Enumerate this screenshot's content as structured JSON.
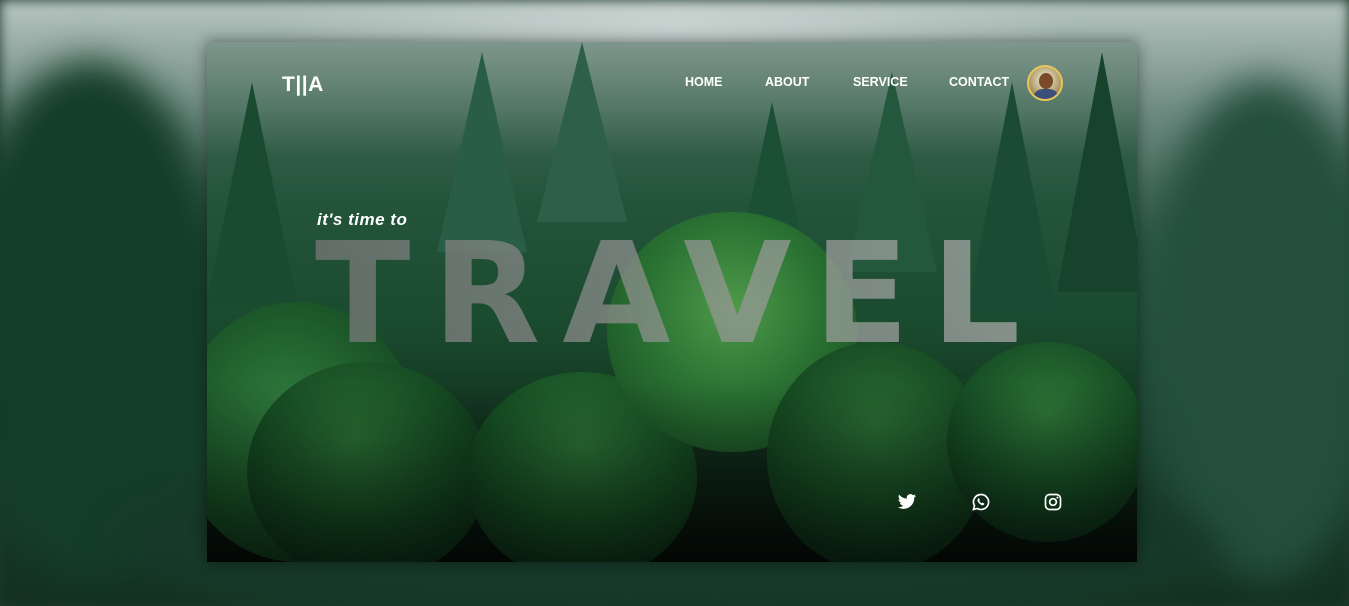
{
  "brand": {
    "logo": "T||A"
  },
  "nav": {
    "items": [
      {
        "label": "HOME"
      },
      {
        "label": "ABOUT"
      },
      {
        "label": "SERVICE"
      },
      {
        "label": "CONTACT"
      }
    ],
    "profile_icon": "user-avatar"
  },
  "hero": {
    "tagline": "it's time to",
    "headline": "TRAVEL"
  },
  "social": {
    "items": [
      {
        "icon": "twitter-icon"
      },
      {
        "icon": "whatsapp-icon"
      },
      {
        "icon": "instagram-icon"
      }
    ]
  },
  "colors": {
    "text": "#ffffff",
    "forest_dark": "#0f2a19",
    "forest_mid": "#24553b",
    "avatar_ring": "#e8c65a"
  }
}
